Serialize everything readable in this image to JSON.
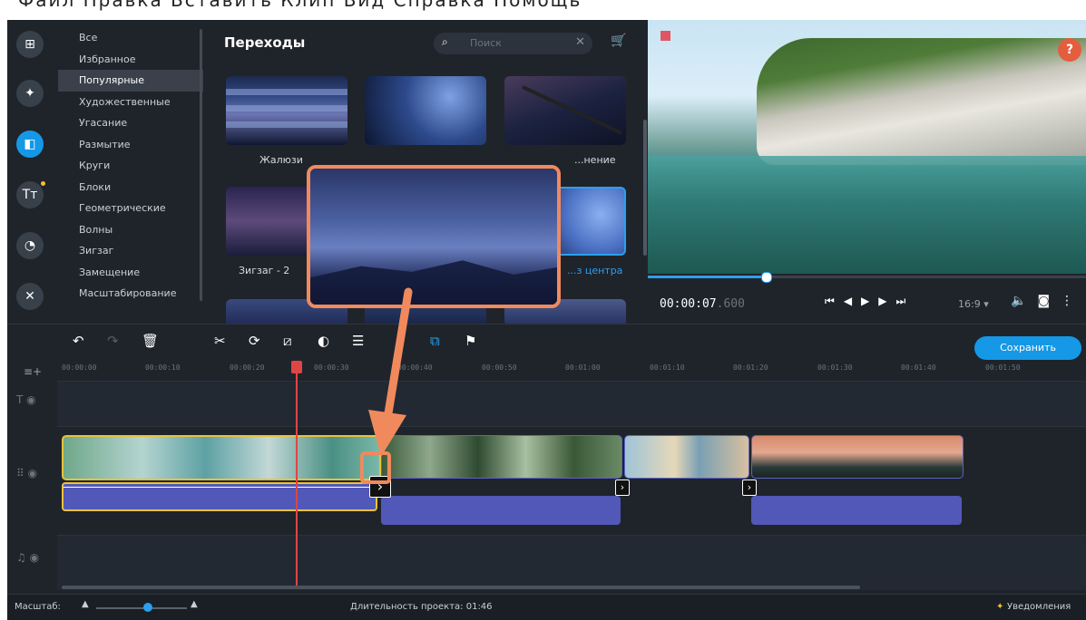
{
  "window": {
    "cut_title": "Файл   Правка   Вставить   Клип   Вид   Справка   Помощь"
  },
  "sidebar": {
    "tools": [
      {
        "icon": "import-icon",
        "glyph": "⊞"
      },
      {
        "icon": "filters-icon",
        "glyph": "✦"
      },
      {
        "icon": "transitions-icon",
        "glyph": "◧"
      },
      {
        "icon": "titles-icon",
        "glyph": "Tт"
      },
      {
        "icon": "stickers-icon",
        "glyph": "◔"
      },
      {
        "icon": "more-tools-icon",
        "glyph": "✕"
      }
    ]
  },
  "categories": [
    "Все",
    "Избранное",
    "Популярные",
    "Художественные",
    "Угасание",
    "Размытие",
    "Круги",
    "Блоки",
    "Геометрические",
    "Волны",
    "Зигзаг",
    "Замещение",
    "Масштабирование"
  ],
  "selected_category": "Популярные",
  "panel": {
    "title": "Переходы",
    "search_placeholder": "Поиск",
    "labels": [
      "Жалюзи",
      "...нение",
      "Зигзаг - 2",
      "...з центра"
    ]
  },
  "player": {
    "timecode": "00:00:07",
    "timecode_ms": ".600",
    "aspect": "16:9 ▾",
    "progress": 0.27,
    "help": "?"
  },
  "toolbar": {
    "save_label": "Сохранить"
  },
  "ruler": [
    "00:00:00",
    "00:00:10",
    "00:00:20",
    "00:00:30",
    "00:00:40",
    "00:00:50",
    "00:01:00",
    "00:01:10",
    "00:01:20",
    "00:01:30",
    "00:01:40",
    "00:01:50"
  ],
  "status": {
    "zoom_label": "Масштаб:",
    "duration": "Длительность проекта: 01:46",
    "notifications": "Уведомления"
  }
}
